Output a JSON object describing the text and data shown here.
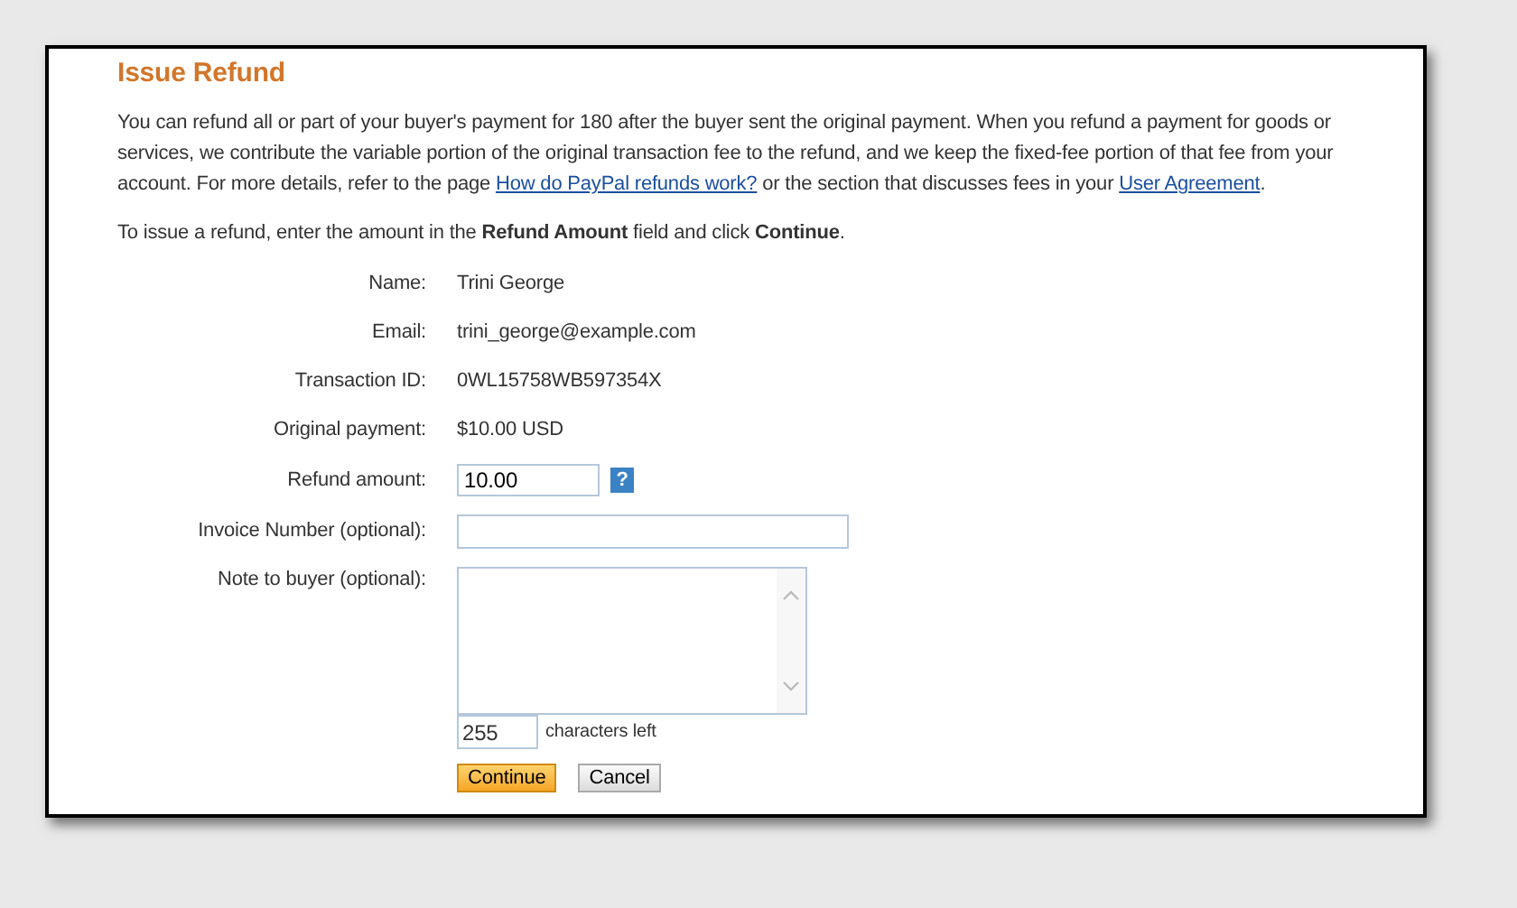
{
  "title": "Issue Refund",
  "intro": [
    {
      "kind": "text",
      "text": "You can refund all or part of your buyer's payment for 180 after the buyer sent the original payment. When you refund a payment for goods or services, we contribute the variable portion of the original transaction fee to the refund, and we keep the fixed-fee portion of that fee from your account. For more details, refer to the page "
    },
    {
      "kind": "link",
      "text": "How do PayPal refunds work?"
    },
    {
      "kind": "text",
      "text": " or the section that discusses fees in your "
    },
    {
      "kind": "link",
      "text": "User Agreement"
    },
    {
      "kind": "text",
      "text": "."
    }
  ],
  "instruction": "To issue a refund, enter the amount in the **Refund Amount** field and click **Continue**.",
  "fields": [
    {
      "kind": "text",
      "label": "Name:",
      "value": "Trini George"
    },
    {
      "kind": "text",
      "label": "Email:",
      "value": "trini_george@example.com"
    },
    {
      "kind": "text",
      "label": "Transaction ID:",
      "value": "0WL15758WB597354X"
    },
    {
      "kind": "text",
      "label": "Original payment:",
      "value": "$10.00 USD"
    },
    {
      "kind": "amount",
      "label": "Refund amount:",
      "value": "10.00",
      "help": "?"
    },
    {
      "kind": "input",
      "label": "Invoice Number (optional):"
    },
    {
      "kind": "textarea",
      "label": "Note to buyer (optional):",
      "counter": "255",
      "counter_label": "characters left"
    }
  ],
  "buttons": [
    {
      "kind": "primary",
      "label": "Continue"
    },
    {
      "kind": "secondary",
      "label": "Cancel"
    }
  ]
}
